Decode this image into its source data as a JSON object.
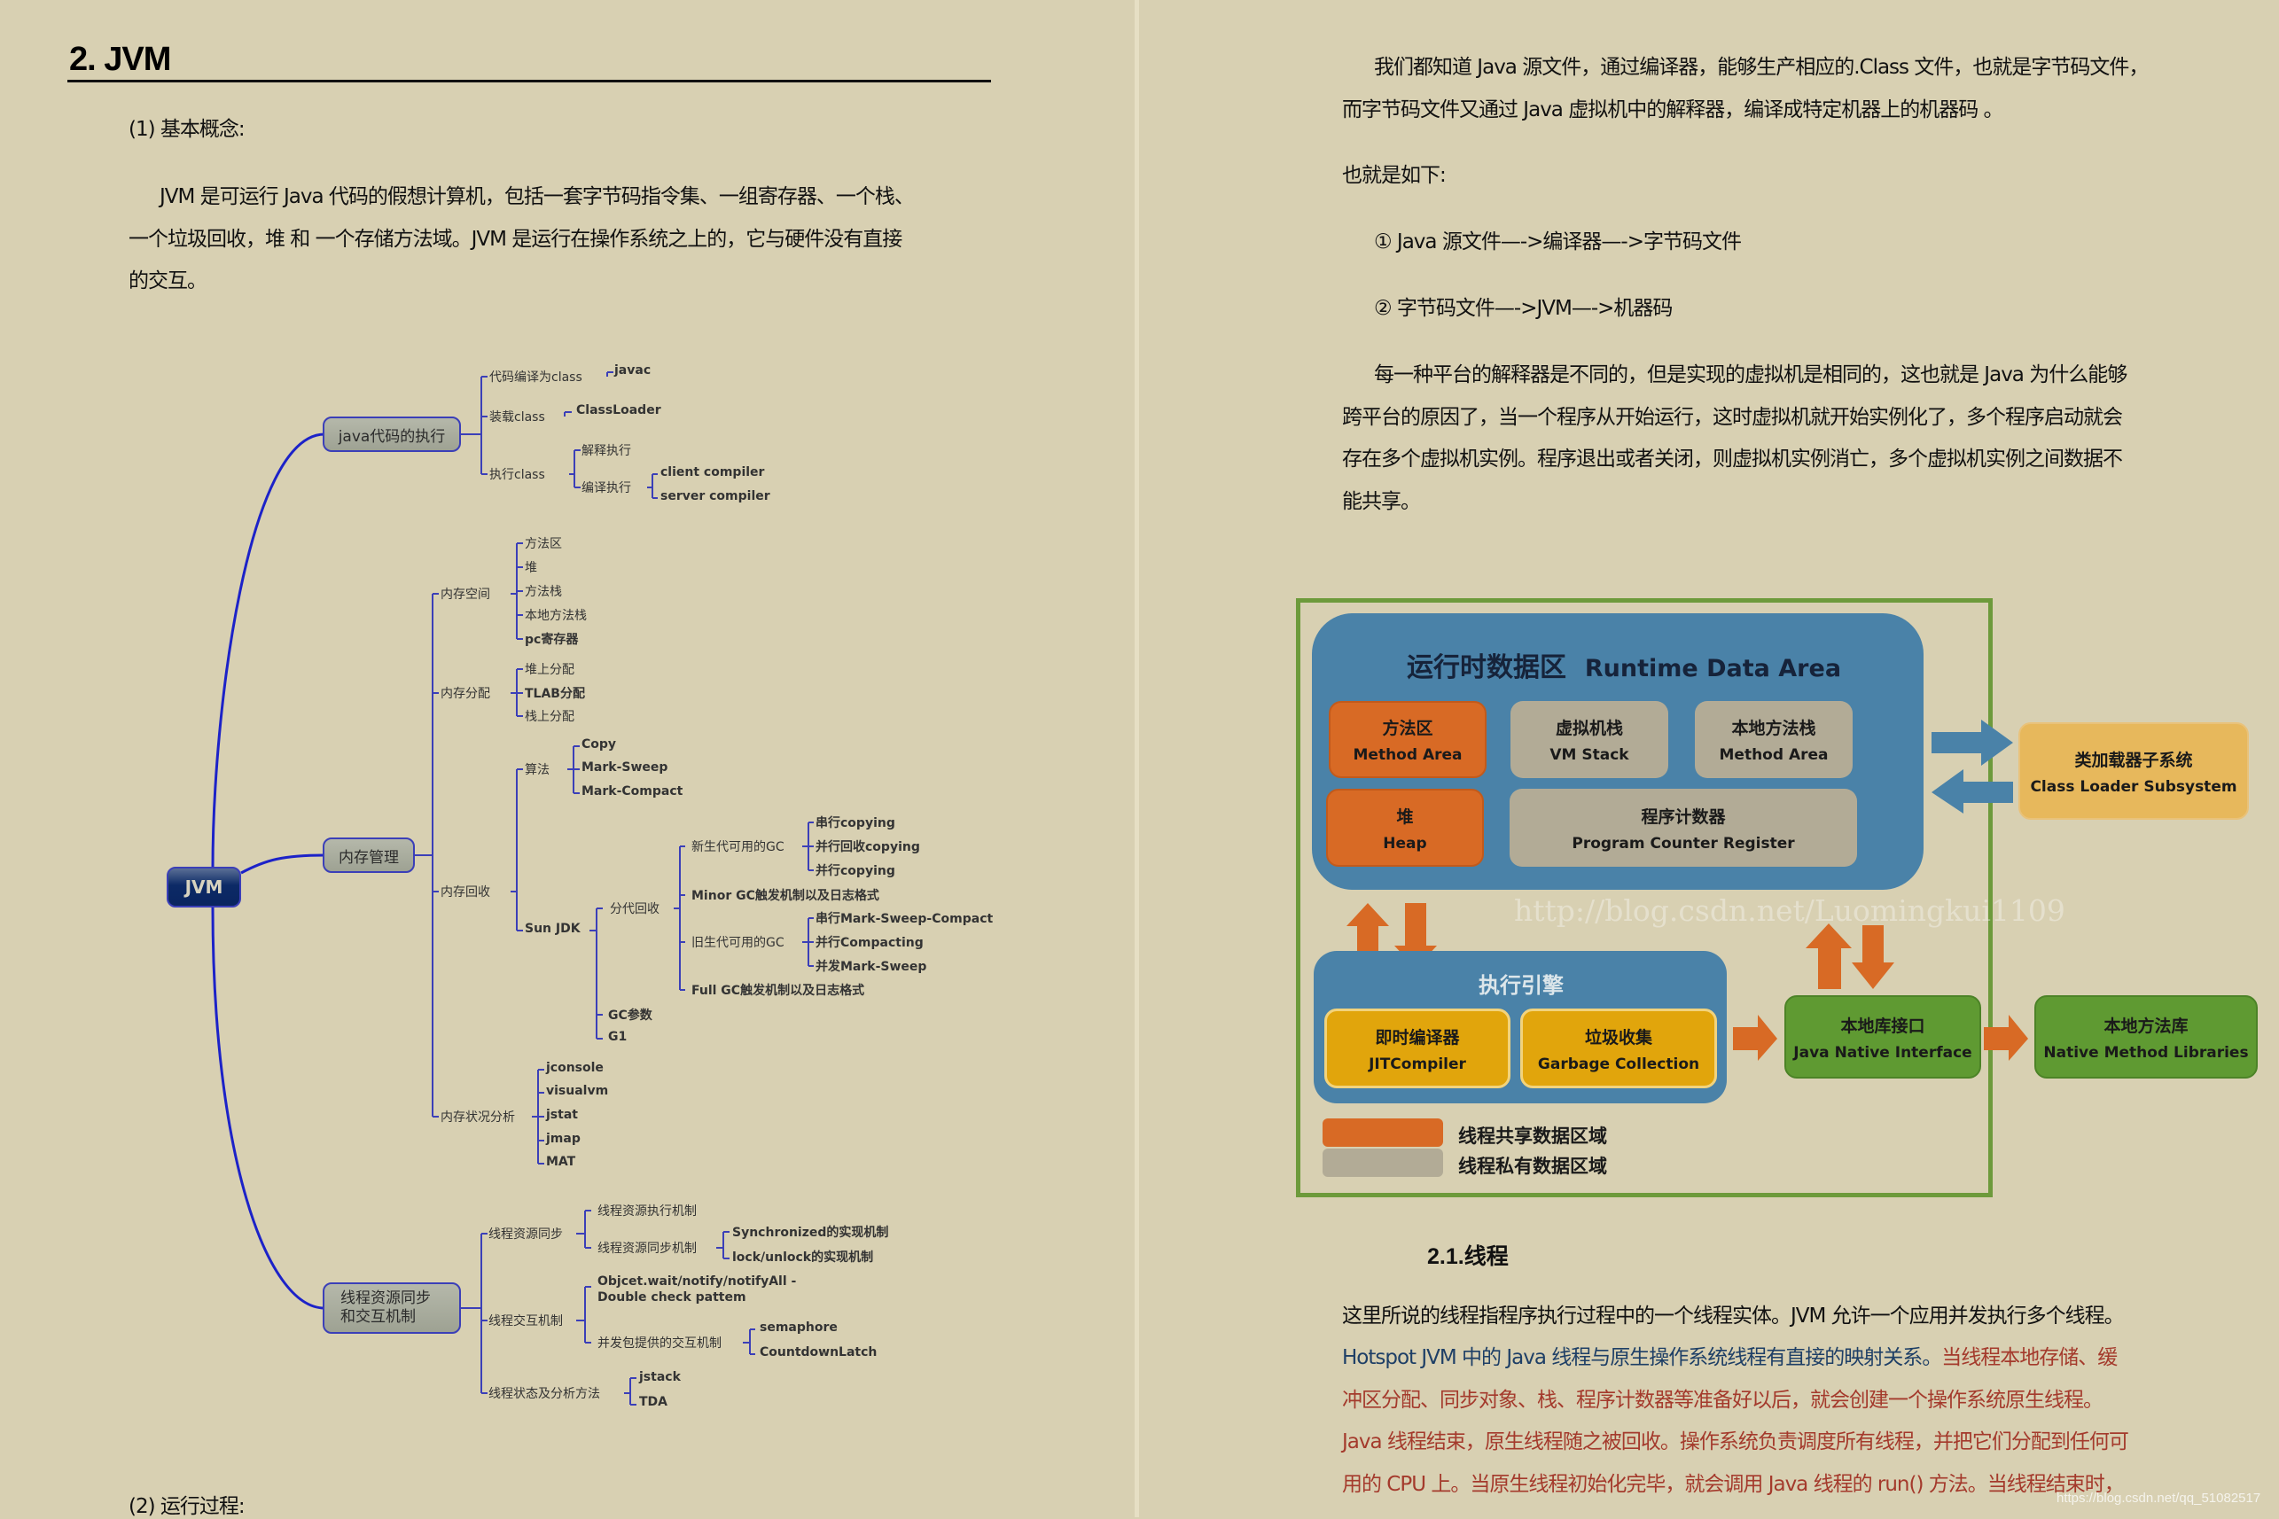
{
  "left_page": {
    "heading": "2. JVM",
    "section1_label": "(1) 基本概念:",
    "para1_lines": [
      "JVM 是可运行 Java 代码的假想计算机，包括一套字节码指令集、一组寄存器、一个栈、",
      "一个垃圾回收，堆 和 一个存储方法域。JVM 是运行在操作系统之上的，它与硬件没有直接",
      "的交互。"
    ],
    "section2_label": "(2) 运行过程:",
    "mindmap": {
      "root": "JVM",
      "branches": [
        {
          "label": "java代码的执行",
          "children": [
            {
              "label": "代码编译为class",
              "children": [
                "javac"
              ]
            },
            {
              "label": "装载class",
              "children": [
                "ClassLoader"
              ]
            },
            {
              "label": "执行class",
              "children": [
                "解释执行",
                "编译执行"
              ],
              "grandchildren": [
                "client compiler",
                "server compiler"
              ]
            }
          ]
        },
        {
          "label": "内存管理",
          "children": [
            {
              "label": "内存空间",
              "children": [
                "方法区",
                "堆",
                "方法栈",
                "本地方法栈",
                "pc寄存器"
              ]
            },
            {
              "label": "内存分配",
              "children": [
                "堆上分配",
                "TLAB分配",
                "栈上分配"
              ]
            },
            {
              "label": "内存回收",
              "children": [
                {
                  "label": "算法",
                  "children": [
                    "Copy",
                    "Mark-Sweep",
                    "Mark-Compact"
                  ]
                },
                {
                  "label": "Sun JDK",
                  "children": [
                    {
                      "label": "分代回收",
                      "children": [
                        {
                          "label": "新生代可用的GC",
                          "children": [
                            "串行copying",
                            "并行回收copying",
                            "并行copying"
                          ]
                        },
                        {
                          "label": "Minor GC触发机制以及日志格式"
                        },
                        {
                          "label": "旧生代可用的GC",
                          "children": [
                            "串行Mark-Sweep-Compact",
                            "并行Compacting",
                            "并发Mark-Sweep"
                          ]
                        },
                        {
                          "label": "Full GC触发机制以及日志格式"
                        }
                      ]
                    },
                    {
                      "label": "GC参数"
                    },
                    {
                      "label": "G1"
                    }
                  ]
                }
              ]
            },
            {
              "label": "内存状况分析",
              "children": [
                "jconsole",
                "visualvm",
                "jstat",
                "jmap",
                "MAT"
              ]
            }
          ]
        },
        {
          "label_lines": [
            "线程资源同步",
            "和交互机制"
          ],
          "children": [
            {
              "label": "线程资源同步",
              "children": [
                "线程资源执行机制",
                "线程资源同步机制"
              ],
              "grandchildren": [
                "Synchronized的实现机制",
                "lock/unlock的实现机制"
              ]
            },
            {
              "label": "线程交互机制",
              "children": [
                "Objcet.wait/notify/notifyAll -",
                "Double check pattem",
                "并发包提供的交互机制"
              ],
              "grandchildren": [
                "semaphore",
                "CountdownLatch"
              ]
            },
            {
              "label": "线程状态及分析方法",
              "children": [
                "jstack",
                "TDA"
              ]
            }
          ]
        }
      ]
    }
  },
  "right_page": {
    "para1_lines": [
      "我们都知道 Java 源文件，通过编译器，能够生产相应的.Class 文件，也就是字节码文件，",
      "而字节码文件又通过 Java 虚拟机中的解释器，编译成特定机器上的机器码 。"
    ],
    "intro": "也就是如下:",
    "step1": "① Java 源文件—->编译器—->字节码文件",
    "step2": "② 字节码文件—->JVM—->机器码",
    "para2_lines": [
      "每一种平台的解释器是不同的，但是实现的虚拟机是相同的，这也就是 Java 为什么能够",
      "跨平台的原因了，当一个程序从开始运行，这时虚拟机就开始实例化了，多个程序启动就会",
      "存在多个虚拟机实例。程序退出或者关闭，则虚拟机实例消亡，多个虚拟机实例之间数据不",
      "能共享。"
    ],
    "diagram": {
      "title_zh": "运行时数据区",
      "title_en": "Runtime Data Area",
      "method_area": {
        "zh": "方法区",
        "en": "Method Area"
      },
      "vm_stack": {
        "zh": "虚拟机栈",
        "en": "VM Stack"
      },
      "native_stack": {
        "zh": "本地方法栈",
        "en": "Method Area"
      },
      "heap": {
        "zh": "堆",
        "en": "Heap"
      },
      "pc_register": {
        "zh": "程序计数器",
        "en": "Program Counter Register"
      },
      "class_loader": {
        "zh": "类加载器子系统",
        "en": "Class Loader Subsystem"
      },
      "engine_title": "执行引擎",
      "jit": {
        "zh": "即时编译器",
        "en": "JITCompiler"
      },
      "gc": {
        "zh": "垃圾收集",
        "en": "Garbage Collection"
      },
      "jni": {
        "zh": "本地库接口",
        "en": "Java Native Interface"
      },
      "native_libs": {
        "zh": "本地方法库",
        "en": "Native Method Libraries"
      },
      "legend_shared": "线程共享数据区域",
      "legend_private": "线程私有数据区域",
      "watermark": "http://blog.csdn.net/Luomingkui1109",
      "colors": {
        "shared": "#d86a25",
        "private": "#b2ab96",
        "frame": "#6d9a3b",
        "area": "#4a82a8"
      }
    },
    "section_heading": "2.1.线程",
    "thread_para": {
      "line1": "这里所说的线程指程序执行过程中的一个线程实体。JVM 允许一个应用并发执行多个线程。",
      "line2_blue": "Hotspot JVM 中的 Java 线程与原生操作系统线程有直接的映射关系。",
      "line2_red": "当线程本地存储、缓",
      "line3_red": "冲区分配、同步对象、栈、程序计数器等准备好以后，就会创建一个操作系统原生线程。",
      "line4_red": "Java 线程结束，原生线程随之被回收。操作系统负责调度所有线程，并把它们分配到任何可",
      "line5_red": "用的 CPU 上。当原生线程初始化完毕，就会调用 Java 线程的 run() 方法。当线程结束时，"
    },
    "footer_watermark": "https://blog.csdn.net/qq_51082517"
  }
}
